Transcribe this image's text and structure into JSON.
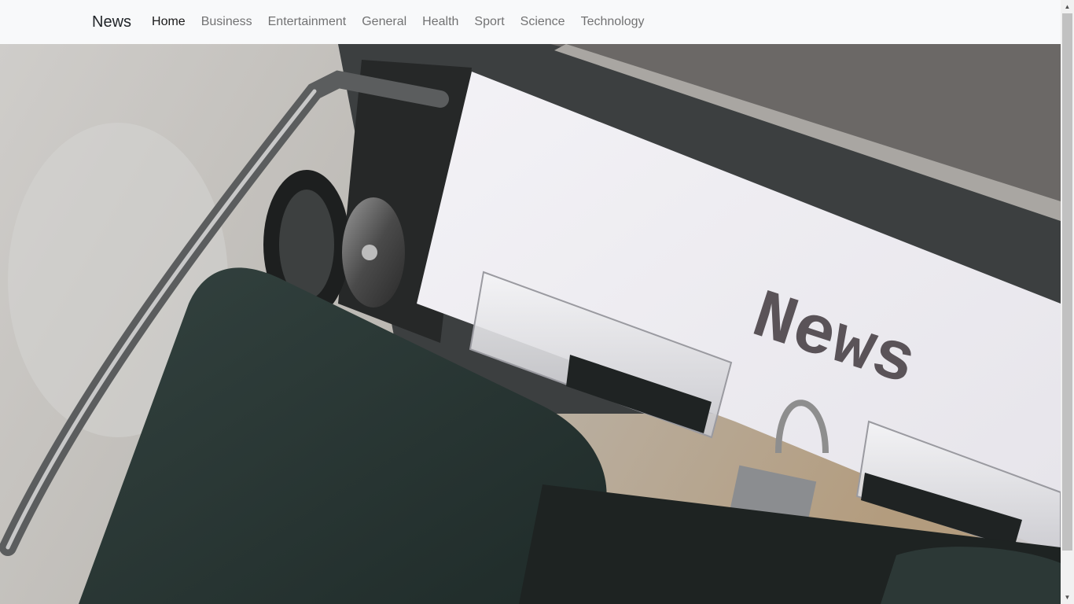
{
  "navbar": {
    "brand": "News",
    "links": [
      {
        "label": "Home",
        "active": true
      },
      {
        "label": "Business"
      },
      {
        "label": "Entertainment"
      },
      {
        "label": "General"
      },
      {
        "label": "Health"
      },
      {
        "label": "Sport"
      },
      {
        "label": "Science"
      },
      {
        "label": "Technology"
      }
    ]
  },
  "hero": {
    "paper_text": "News",
    "colors": {
      "desk": "#c9c6c0",
      "typewriter_body": "#2d3a38",
      "paper": "#ecebef",
      "ink": "#5a5358"
    }
  },
  "scrollbar": {
    "up_icon": "triangle-up-icon",
    "down_icon": "triangle-down-icon"
  }
}
